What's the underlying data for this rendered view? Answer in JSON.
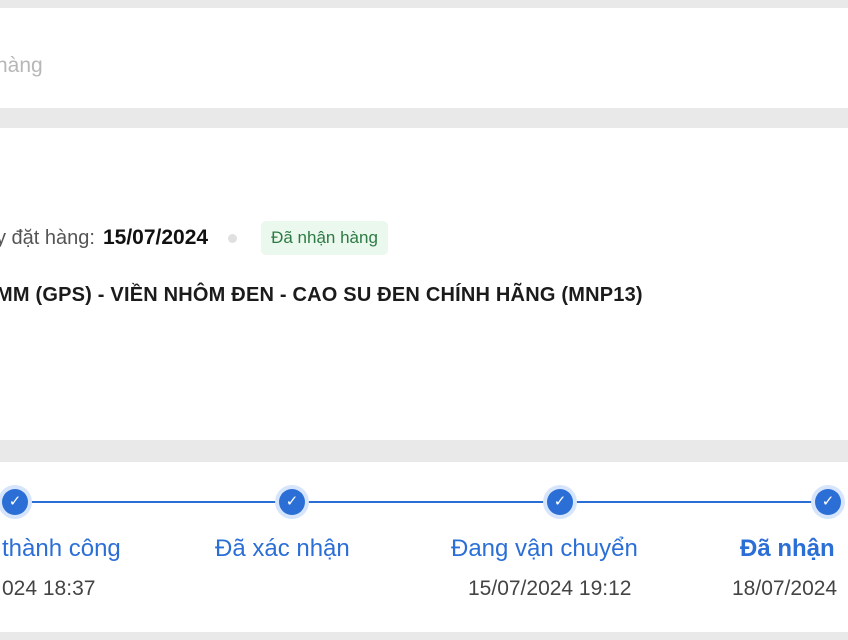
{
  "search": {
    "hint": "hàng"
  },
  "order": {
    "date_label": "y đặt hàng:",
    "date_value": "15/07/2024",
    "status_badge": "Đã nhận hàng",
    "product_name": "MM (GPS) - VIỀN NHÔM ĐEN - CAO SU ĐEN CHÍNH HÃNG (MNP13)"
  },
  "timeline": {
    "accent": "#2b6fd6",
    "steps": [
      {
        "title": "thành công",
        "time": "024 18:37"
      },
      {
        "title": "Đã xác nhận",
        "time": ""
      },
      {
        "title": "Đang vận chuyển",
        "time": "15/07/2024 19:12"
      },
      {
        "title": "Đã nhận",
        "time": "18/07/2024"
      }
    ]
  }
}
